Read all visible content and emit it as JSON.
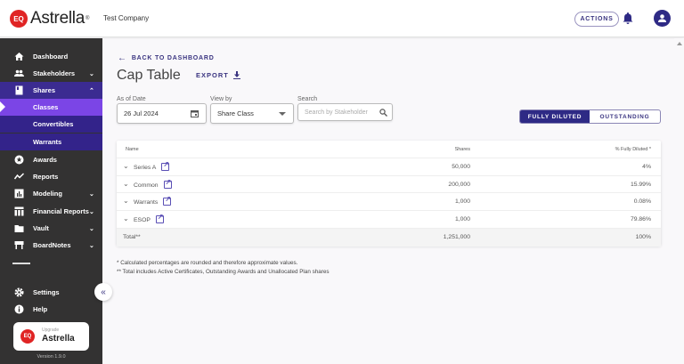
{
  "header": {
    "brand": "Astrella",
    "brand_badge": "EQ",
    "company": "Test Company",
    "actions_label": "ACTIONS"
  },
  "sidebar": {
    "items": [
      {
        "label": "Dashboard",
        "icon": "home-icon"
      },
      {
        "label": "Stakeholders",
        "icon": "people-icon",
        "chevron": "⌄"
      },
      {
        "label": "Shares",
        "icon": "shares-icon",
        "chevron": "⌃"
      },
      {
        "label": "Classes"
      },
      {
        "label": "Convertibles"
      },
      {
        "label": "Warrants"
      },
      {
        "label": "Awards",
        "icon": "award-icon"
      },
      {
        "label": "Reports",
        "icon": "reports-icon"
      },
      {
        "label": "Modeling",
        "icon": "modeling-icon",
        "chevron": "⌄"
      },
      {
        "label": "Financial Reports",
        "icon": "financial-icon",
        "chevron": "⌄"
      },
      {
        "label": "Vault",
        "icon": "folder-icon",
        "chevron": "⌄"
      },
      {
        "label": "BoardNotes",
        "icon": "board-icon",
        "chevron": "⌄"
      }
    ],
    "settings": "Settings",
    "help": "Help",
    "upgrade_small": "Upgrade",
    "upgrade_big": "Astrella",
    "upgrade_badge": "EQ",
    "version": "Version 1.9.0"
  },
  "main": {
    "back": "BACK TO DASHBOARD",
    "title": "Cap Table",
    "export": "EXPORT",
    "date_label": "As of Date",
    "date_value": "26 Jul 2024",
    "viewby_label": "View by",
    "viewby_value": "Share Class",
    "search_label": "Search",
    "search_placeholder": "Search by Stakeholder",
    "toggle": {
      "fully_diluted": "FULLY DILUTED",
      "outstanding": "OUTSTANDING",
      "selected": "FULLY DILUTED"
    },
    "table": {
      "headers": {
        "name": "Name",
        "shares": "Shares",
        "pct": "% Fully Diluted *"
      },
      "rows": [
        {
          "name": "Series A",
          "shares": "50,000",
          "pct": "4%"
        },
        {
          "name": "Common",
          "shares": "200,000",
          "pct": "15.99%"
        },
        {
          "name": "Warrants",
          "shares": "1,000",
          "pct": "0.08%"
        },
        {
          "name": "ESOP",
          "shares": "1,000",
          "pct": "79.86%"
        }
      ],
      "total": {
        "name": "Total**",
        "shares": "1,251,000",
        "pct": "100%"
      }
    },
    "notes": [
      "* Calculated percentages are rounded and therefore approximate values.",
      "** Total includes Active Certificates, Outstanding Awards and Unallocated Plan shares"
    ]
  },
  "colors": {
    "primary": "#2e2a85",
    "active_nav": "#7b45e6",
    "sidebar": "#333232",
    "brand_red": "#e02424"
  }
}
